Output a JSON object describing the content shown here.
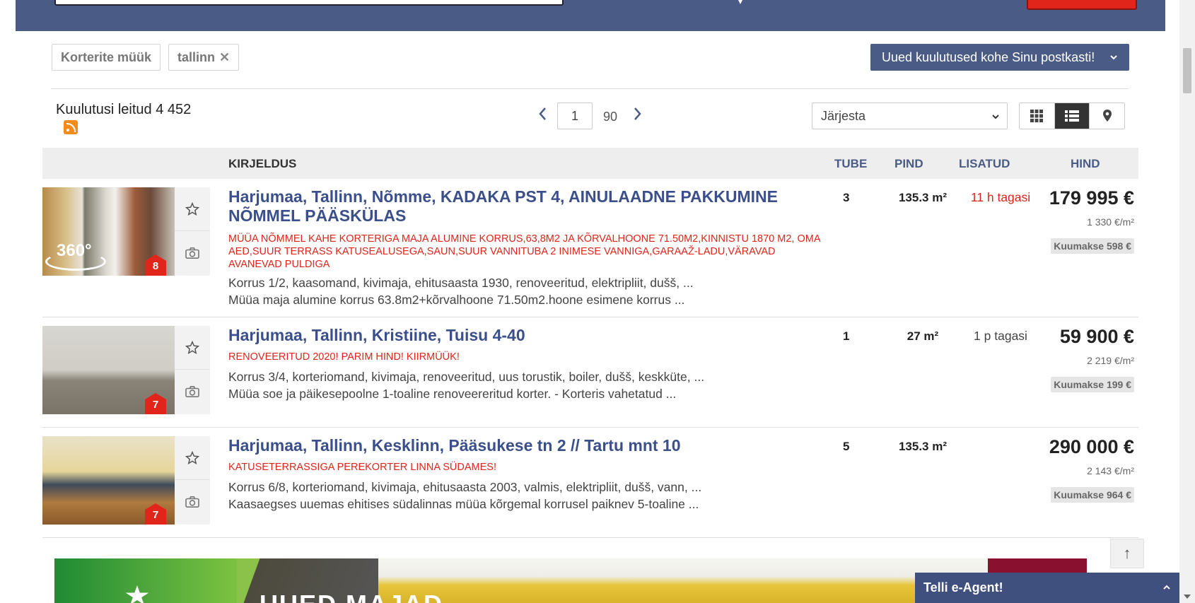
{
  "filters": [
    {
      "label": "Korterite müük",
      "removable": false
    },
    {
      "label": "tallinn",
      "removable": true
    }
  ],
  "filter_remove_glyph": "✕",
  "agent_button": {
    "label": "Uued kuulutused kohe Sinu postkasti!",
    "icon": "chevron-down-icon"
  },
  "results": {
    "label": "Kuulutusi leitud 4 452",
    "rss_icon": "rss-icon"
  },
  "pagination": {
    "current": "1",
    "total": "90",
    "prev_icon": "chevron-left-icon",
    "next_icon": "chevron-right-icon"
  },
  "sort": {
    "selected": "Järjesta"
  },
  "view_modes": [
    {
      "name": "grid",
      "icon": "grid-icon",
      "active": false
    },
    {
      "name": "list",
      "icon": "list-icon",
      "active": true
    },
    {
      "name": "map",
      "icon": "map-pin-icon",
      "active": false
    }
  ],
  "table_header": {
    "description": "KIRJELDUS",
    "rooms": "TUBE",
    "area": "PIND",
    "added": "LISATUD",
    "price": "HIND"
  },
  "listings": [
    {
      "title": "Harjumaa, Tallinn, Nõmme, KADAKA PST 4, AINULAADNE PAKKUMINE NÕMMEL PÄÄSKÜLAS",
      "highlight": "MÜÜA NÕMMEL KAHE KORTERIGA MAJA ALUMINE KORRUS,63,8M2 JA KÕRVALHOONE 71.50M2,KINNISTU 1870 M2, OMA AED,SUUR TERRASS KATUSEALUSEGA,SAUN,SUUR VANNITUBA 2 INIMESE VANNIGA,GARAAŽ-LADU,VÄRAVAD AVANEVAD PULDIGA",
      "details": "Korrus 1/2, kaasomand, kivimaja, ehitusaasta 1930, renoveeritud, elektripliit, dušš, ...",
      "summary": "Müüa maja alumine korrus 63.8m2+kõrvalhoone 71.50m2.hoone esimene korrus ...",
      "rooms": "3",
      "area": "135.3 m²",
      "added": "11 h tagasi",
      "price": "179 995 €",
      "price_per_m2": "1 330 €/m²",
      "monthly": "Kuumakse 598 €",
      "photo_count": "8",
      "has_360": true,
      "badge_360": "360°"
    },
    {
      "title": "Harjumaa, Tallinn, Kristiine, Tuisu 4-40",
      "highlight": "RENOVEERITUD 2020! PARIM HIND! KIIRMÜÜK!",
      "details": "Korrus 3/4, korteriomand, kivimaja, renoveeritud, uus torustik, boiler, dušš, keskküte, ...",
      "summary": "Müüa soe ja päikesepoolne 1-toaline renoveereritud korter. - Korteris vahetatud ...",
      "rooms": "1",
      "area": "27 m²",
      "added": "1 p tagasi",
      "price": "59 900 €",
      "price_per_m2": "2 219 €/m²",
      "monthly": "Kuumakse 199 €",
      "photo_count": "7",
      "has_360": false
    },
    {
      "title": "Harjumaa, Tallinn, Kesklinn, Pääsukese tn 2 // Tartu mnt 10",
      "highlight": "KATUSETERRASSIGA PEREKORTER LINNA SÜDAMES!",
      "details": "Korrus 6/8, korteriomand, kivimaja, ehitusaasta 2003, valmis, elektripliit, dušš, vann, ...",
      "summary": "Kaasaegses uuemas ehitises südalinnas müüa kõrgemal korrusel paiknev 5-toaline ...",
      "rooms": "5",
      "area": "135.3 m²",
      "added": "",
      "price": "290 000 €",
      "price_per_m2": "2 143 €/m²",
      "monthly": "Kuumakse 964 €",
      "photo_count": "7",
      "has_360": false
    }
  ],
  "banner": {
    "text": "UUED MAJAD"
  },
  "back_to_top": "↑",
  "eagent": {
    "label": "Telli e-Agent!",
    "icon": "chevron-up-icon"
  },
  "colors": {
    "brand": "#4a5b86",
    "accent_red": "#e1251b",
    "title_blue": "#3a4f8c"
  }
}
